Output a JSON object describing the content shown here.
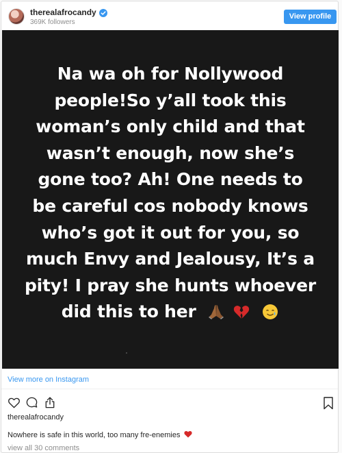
{
  "header": {
    "username": "therealafrocandy",
    "followers": "369K followers",
    "view_profile_label": "View profile"
  },
  "post": {
    "lines": [
      "Na wa oh for Nollywood",
      "people!So y’all took this",
      "woman’s only child and that",
      "wasn’t enough, now she’s",
      "gone too? Ah! One needs to",
      "be careful cos nobody knows",
      "who’s got it out for you, so",
      "much Envy and Jealousy, It’s a",
      "pity! I pray she hunts whoever",
      "did this to her"
    ],
    "emojis": [
      "folded-hands",
      "broken-heart",
      "smiling-face-with-tear"
    ]
  },
  "view_more_label": "View more on Instagram",
  "actions": [
    "heart-icon",
    "comment-icon",
    "share-icon",
    "bookmark-icon"
  ],
  "caption": {
    "username": "therealafrocandy",
    "text": "Nowhere is safe in this world, too many fre-enemies",
    "view_comments": "view all 30 comments"
  },
  "colors": {
    "accent": "#3897f0",
    "media_background": "#181818",
    "text": "#262626",
    "muted": "#8e8e8e"
  }
}
